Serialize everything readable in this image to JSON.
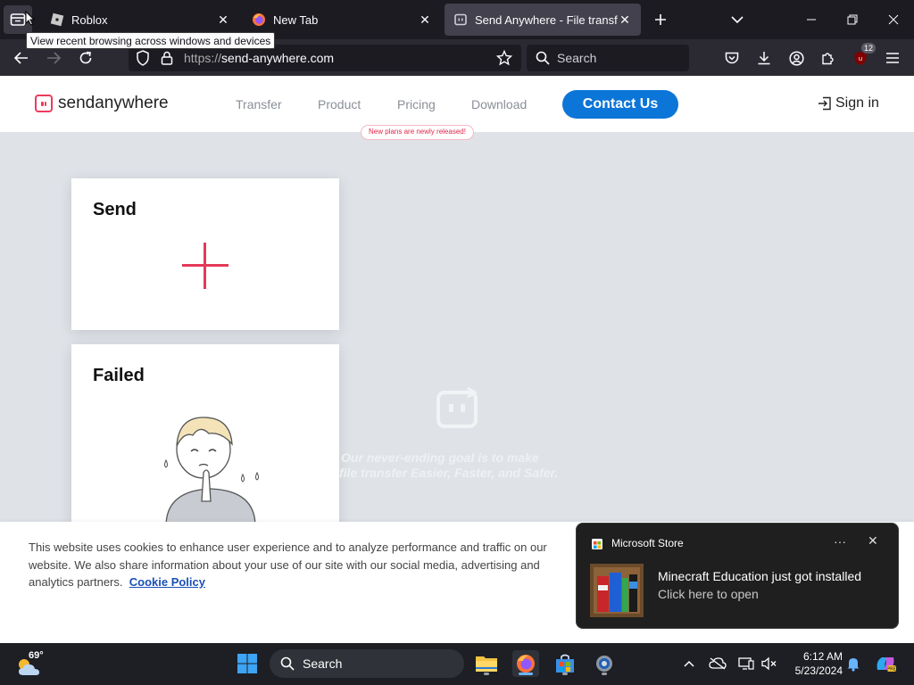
{
  "browser": {
    "tabs": [
      {
        "label": "Roblox"
      },
      {
        "label": "New Tab"
      },
      {
        "label": "Send Anywhere - File transfer"
      }
    ],
    "tooltip": "View recent browsing across windows and devices",
    "url_proto": "https://",
    "url_host": "send-anywhere.com",
    "search_placeholder": "Search",
    "extension_badge": "12"
  },
  "site": {
    "logo_prefix": "send",
    "logo_suffix": "anywhere",
    "nav": [
      "Transfer",
      "Product",
      "Pricing",
      "Download"
    ],
    "new_badge": "New plans are newly released!",
    "contact_button": "Contact Us",
    "sign_in": "Sign in",
    "send_card_title": "Send",
    "failed_card_title": "Failed",
    "slogan_line1": "Our never-ending goal is to make",
    "slogan_line2": "file transfer Easier, Faster, and Safer."
  },
  "cookie": {
    "text": "This website uses cookies to enhance user experience and to analyze performance and traffic on our website. We also share information about your use of our site with our social media, advertising and analytics partners.",
    "link": "Cookie Policy"
  },
  "toast": {
    "app_name": "Microsoft Store",
    "more": "···",
    "title": "Minecraft Education just got installed",
    "subtitle": "Click here to open"
  },
  "taskbar": {
    "temperature": "69°",
    "search_label": "Search",
    "time": "6:12 AM",
    "date": "5/23/2024"
  },
  "colors": {
    "brand_red": "#ed3b5c",
    "contact_blue": "#0c75d8",
    "page_bg": "#dfe3e8"
  }
}
